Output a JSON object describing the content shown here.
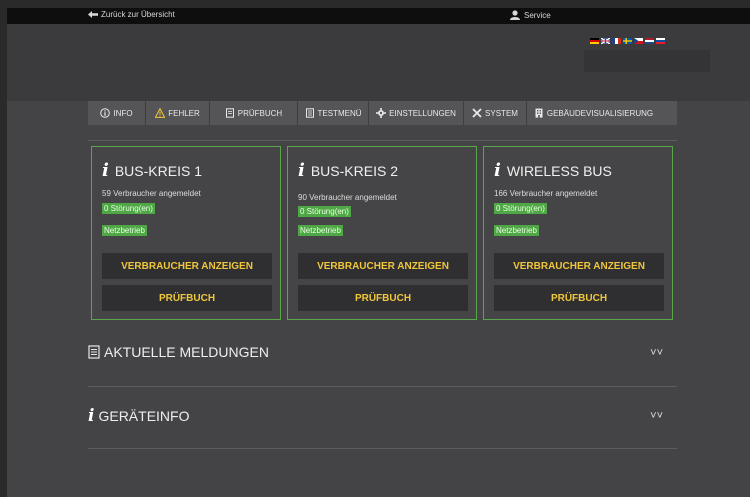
{
  "topbar": {
    "back_label": "Zurück zur Übersicht",
    "service_label": "Service"
  },
  "nav": {
    "items": [
      {
        "label": "INFO",
        "icon": "info-circle-icon"
      },
      {
        "label": "FEHLER",
        "icon": "warning-icon"
      },
      {
        "label": "PRÜFBUCH",
        "icon": "book-icon"
      },
      {
        "label": "TESTMENÜ",
        "icon": "test-icon"
      },
      {
        "label": "EINSTELLUNGEN",
        "icon": "gear-icon"
      },
      {
        "label": "SYSTEM",
        "icon": "tools-icon"
      },
      {
        "label": "GEBÄUDEVISUALISIERUNG",
        "icon": "building-icon"
      }
    ]
  },
  "cards": [
    {
      "title": "BUS-KREIS 1",
      "count": "59 Verbraucher angemeldet",
      "status": "0 Störung(en)",
      "mode": "Netzbetrieb",
      "btn_show": "VERBRAUCHER ANZEIGEN",
      "btn_book": "PRÜFBUCH"
    },
    {
      "title": "BUS-KREIS 2",
      "count": "90 Verbraucher angemeldet",
      "status": "0 Störung(en)",
      "mode": "Netzbetrieb",
      "btn_show": "VERBRAUCHER ANZEIGEN",
      "btn_book": "PRÜFBUCH"
    },
    {
      "title": "WIRELESS BUS",
      "count": "166 Verbraucher angemeldet",
      "status": "0 Störung(en)",
      "mode": "Netzbetrieb",
      "btn_show": "VERBRAUCHER ANZEIGEN",
      "btn_book": "PRÜFBUCH"
    }
  ],
  "sections": {
    "messages_title": "AKTUELLE MELDUNGEN",
    "device_title": "GERÄTEINFO"
  },
  "colors": {
    "accent": "#f0c63a",
    "ok": "#4fa845",
    "border": "#5aa64c"
  }
}
